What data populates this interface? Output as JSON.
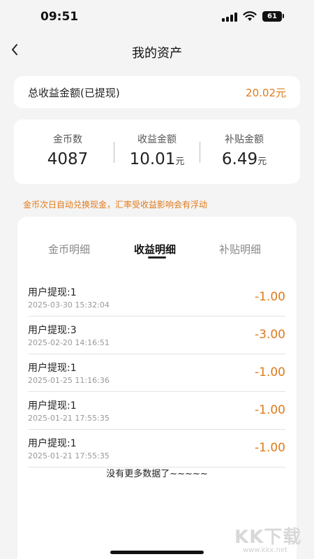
{
  "status_bar": {
    "time": "09:51",
    "battery": "61"
  },
  "nav": {
    "title": "我的资产",
    "back_icon": "chevron-left-icon"
  },
  "total": {
    "label": "总收益金额(已提现)",
    "value": "20.02元"
  },
  "stats": [
    {
      "label": "金币数",
      "value": "4087",
      "unit": ""
    },
    {
      "label": "收益金额",
      "value": "10.01",
      "unit": "元"
    },
    {
      "label": "补贴金额",
      "value": "6.49",
      "unit": "元"
    }
  ],
  "notice": "金币次日自动兑换现金，汇率受收益影响会有浮动",
  "tabs": [
    {
      "label": "金币明细",
      "active": false
    },
    {
      "label": "收益明细",
      "active": true
    },
    {
      "label": "补贴明细",
      "active": false
    }
  ],
  "records": [
    {
      "title": "用户提现:1",
      "time": "2025-03-30 15:32:04",
      "amount": "-1.00"
    },
    {
      "title": "用户提现:3",
      "time": "2025-02-20 14:16:51",
      "amount": "-3.00"
    },
    {
      "title": "用户提现:1",
      "time": "2025-01-25 11:16:36",
      "amount": "-1.00"
    },
    {
      "title": "用户提现:1",
      "time": "2025-01-21 17:55:35",
      "amount": "-1.00"
    },
    {
      "title": "用户提现:1",
      "time": "2025-01-21 17:55:35",
      "amount": "-1.00"
    }
  ],
  "no_more": "没有更多数据了~~~~~",
  "watermark": {
    "text": "KK下载",
    "url": "www.kkx.net"
  },
  "colors": {
    "accent": "#e07a1a",
    "background": "#f4f4f4",
    "card": "#ffffff"
  }
}
